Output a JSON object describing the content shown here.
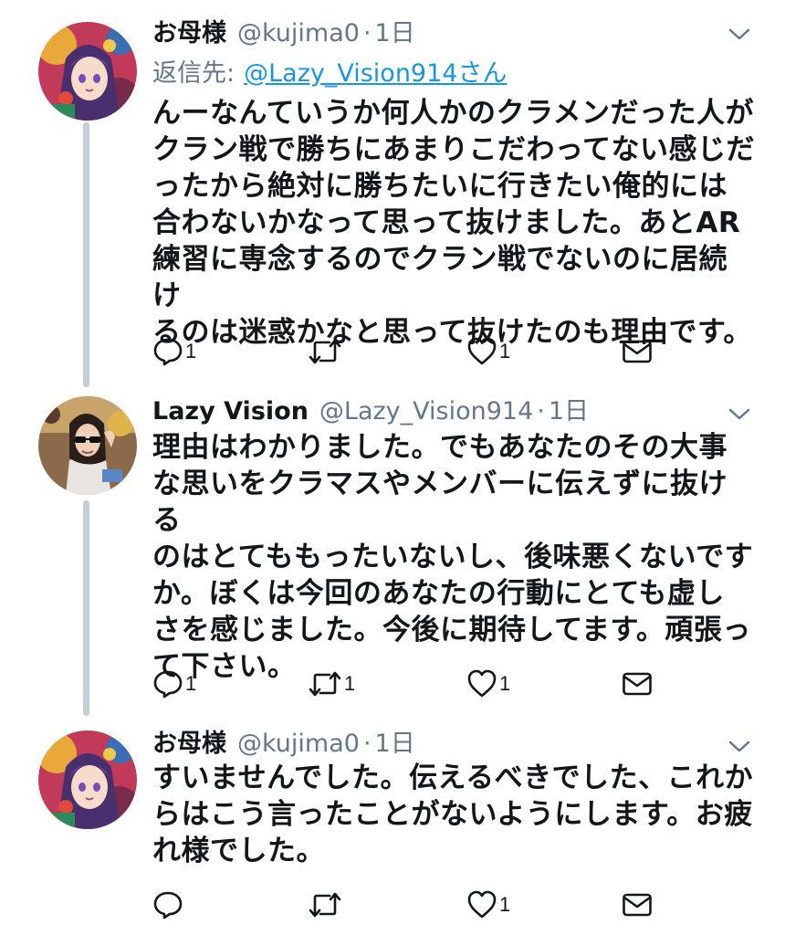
{
  "tweets": [
    {
      "name": "お母様",
      "handle": "@kujima0",
      "dot": "·",
      "time": "1日",
      "reply_to_label": "返信先:",
      "reply_to_link": "@Lazy_Vision914さん",
      "lines": [
        "んーなんていうか何人かのクラメンだった人が",
        "クラン戦で勝ちにあまりこだわってない感じだ",
        "ったから絶対に勝ちたいに行きたい俺的には",
        "合わないかなって思って抜けました。あとAR",
        "練習に専念するのでクラン戦でないのに居続け",
        "るのは迷惑かなと思って抜けたのも理由です。"
      ],
      "reply_count": "1",
      "retweet_count": "",
      "like_count": "1",
      "avatar_icon": "anime-avatar-icon"
    },
    {
      "name": "Lazy Vision",
      "handle": "@Lazy_Vision914",
      "dot": "·",
      "time": "1日",
      "lines": [
        "理由はわかりました。でもあなたのその大事",
        "な思いをクラマスやメンバーに伝えずに抜ける",
        "のはとてももったいないし、後味悪くないです",
        "か。ぼくは今回のあなたの行動にとても虚し",
        "さを感じました。今後に期待してます。頑張っ",
        "て下さい。"
      ],
      "reply_count": "1",
      "retweet_count": "1",
      "like_count": "1",
      "avatar_icon": "photo-avatar-icon"
    },
    {
      "name": "お母様",
      "handle": "@kujima0",
      "dot": "·",
      "time": "1日",
      "lines": [
        "すいませんでした。伝えるべきでした、これか",
        "らはこう言ったことがないようにします。お疲",
        "れ様でした。"
      ],
      "reply_count": "",
      "retweet_count": "",
      "like_count": "1",
      "avatar_icon": "anime-avatar-icon"
    }
  ],
  "colors": {
    "text": "#14171a",
    "secondary": "#657786",
    "link": "#1b95e0",
    "thread_line": "#c6cfd6"
  }
}
